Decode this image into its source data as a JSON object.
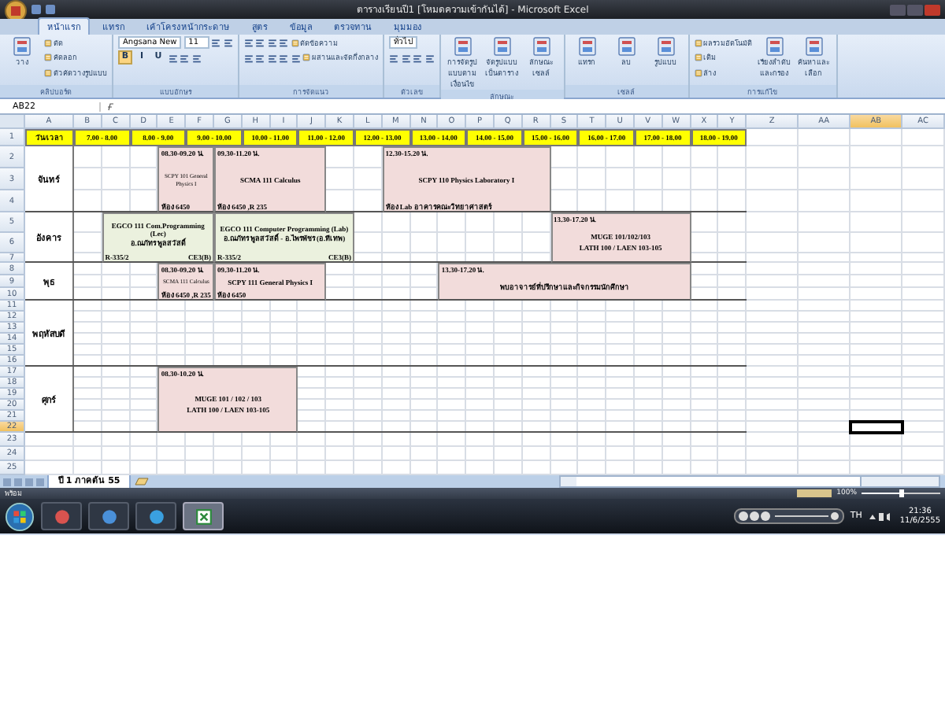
{
  "window": {
    "title": "ตารางเรียนปี1 [โหมดความเข้ากันได้] - Microsoft Excel"
  },
  "ribbon": {
    "tabs": [
      {
        "label": "หน้าแรก",
        "selected": true
      },
      {
        "label": "แทรก",
        "selected": false
      },
      {
        "label": "เค้าโครงหน้ากระดาษ",
        "selected": false
      },
      {
        "label": "สูตร",
        "selected": false
      },
      {
        "label": "ข้อมูล",
        "selected": false
      },
      {
        "label": "ตรวจทาน",
        "selected": false
      },
      {
        "label": "มุมมอง",
        "selected": false
      }
    ],
    "groups": [
      {
        "label": "คลิปบอร์ด",
        "parts": [
          {
            "kind": "large",
            "label": "วาง"
          },
          {
            "kind": "stack",
            "lines": [
              {
                "items": [
                  {
                    "kind": "small",
                    "label": "ตัด"
                  }
                ]
              },
              {
                "items": [
                  {
                    "kind": "small",
                    "label": "คัดลอก"
                  }
                ]
              },
              {
                "items": [
                  {
                    "kind": "small",
                    "label": "ตัวคัดวางรูปแบบ"
                  }
                ]
              }
            ]
          }
        ]
      },
      {
        "label": "แบบอักษร",
        "parts": [
          {
            "kind": "stack",
            "lines": [
              {
                "items": [
                  {
                    "kind": "field",
                    "value": "Angsana New"
                  },
                  {
                    "kind": "field",
                    "value": "11"
                  },
                  {
                    "kind": "tool"
                  },
                  {
                    "kind": "tool"
                  }
                ]
              },
              {
                "items": [
                  {
                    "kind": "glyph",
                    "label": "B",
                    "on": true
                  },
                  {
                    "kind": "glyph",
                    "label": "I",
                    "on": false
                  },
                  {
                    "kind": "glyph",
                    "label": "U",
                    "on": false
                  },
                  {
                    "kind": "tool"
                  },
                  {
                    "kind": "tool"
                  },
                  {
                    "kind": "tool"
                  }
                ]
              }
            ]
          }
        ]
      },
      {
        "label": "การจัดแนว",
        "parts": [
          {
            "kind": "stack",
            "lines": [
              {
                "items": [
                  {
                    "kind": "tool"
                  },
                  {
                    "kind": "tool"
                  },
                  {
                    "kind": "tool"
                  },
                  {
                    "kind": "tool"
                  },
                  {
                    "kind": "small",
                    "label": "ตัดข้อความ"
                  }
                ]
              },
              {
                "items": [
                  {
                    "kind": "tool"
                  },
                  {
                    "kind": "tool"
                  },
                  {
                    "kind": "tool"
                  },
                  {
                    "kind": "tool"
                  },
                  {
                    "kind": "tool"
                  },
                  {
                    "kind": "small",
                    "label": "ผสานและจัดกึ่งกลาง"
                  }
                ]
              }
            ]
          }
        ]
      },
      {
        "label": "ตัวเลข",
        "parts": [
          {
            "kind": "stack",
            "lines": [
              {
                "items": [
                  {
                    "kind": "field",
                    "value": "ทั่วไป"
                  }
                ]
              },
              {
                "items": [
                  {
                    "kind": "tool"
                  },
                  {
                    "kind": "tool"
                  },
                  {
                    "kind": "tool"
                  },
                  {
                    "kind": "tool"
                  }
                ]
              }
            ]
          }
        ]
      },
      {
        "label": "ลักษณะ",
        "parts": [
          {
            "kind": "large",
            "label": "การจัดรูปแบบตามเงื่อนไข"
          },
          {
            "kind": "large",
            "label": "จัดรูปแบบเป็นตาราง"
          },
          {
            "kind": "large",
            "label": "ลักษณะเซลล์"
          }
        ]
      },
      {
        "label": "เซลล์",
        "parts": [
          {
            "kind": "large",
            "label": "แทรก"
          },
          {
            "kind": "large",
            "label": "ลบ"
          },
          {
            "kind": "large",
            "label": "รูปแบบ"
          }
        ]
      },
      {
        "label": "การแก้ไข",
        "parts": [
          {
            "kind": "stack",
            "lines": [
              {
                "items": [
                  {
                    "kind": "small",
                    "label": "ผลรวมอัตโนมัติ"
                  }
                ]
              },
              {
                "items": [
                  {
                    "kind": "small",
                    "label": "เติม"
                  }
                ]
              },
              {
                "items": [
                  {
                    "kind": "small",
                    "label": "ล้าง"
                  }
                ]
              }
            ]
          },
          {
            "kind": "large",
            "label": "เรียงลำดับและกรอง"
          },
          {
            "kind": "large",
            "label": "ค้นหาและเลือก"
          }
        ]
      }
    ]
  },
  "formula_bar": {
    "name_box": "AB22"
  },
  "sheet": {
    "columns": [
      {
        "label": "A",
        "selected": false
      },
      {
        "label": "B",
        "selected": false
      },
      {
        "label": "C",
        "selected": false
      },
      {
        "label": "D",
        "selected": false
      },
      {
        "label": "E",
        "selected": false
      },
      {
        "label": "F",
        "selected": false
      },
      {
        "label": "G",
        "selected": false
      },
      {
        "label": "H",
        "selected": false
      },
      {
        "label": "I",
        "selected": false
      },
      {
        "label": "J",
        "selected": false
      },
      {
        "label": "K",
        "selected": false
      },
      {
        "label": "L",
        "selected": false
      },
      {
        "label": "M",
        "selected": false
      },
      {
        "label": "N",
        "selected": false
      },
      {
        "label": "O",
        "selected": false
      },
      {
        "label": "P",
        "selected": false
      },
      {
        "label": "Q",
        "selected": false
      },
      {
        "label": "R",
        "selected": false
      },
      {
        "label": "S",
        "selected": false
      },
      {
        "label": "T",
        "selected": false
      },
      {
        "label": "U",
        "selected": false
      },
      {
        "label": "V",
        "selected": false
      },
      {
        "label": "W",
        "selected": false
      },
      {
        "label": "X",
        "selected": false
      },
      {
        "label": "Y",
        "selected": false
      },
      {
        "label": "Z",
        "selected": false
      },
      {
        "label": "AA",
        "selected": false
      },
      {
        "label": "AB",
        "selected": true
      },
      {
        "label": "AC",
        "selected": false
      }
    ],
    "header_row": {
      "label": "1",
      "selected": false,
      "corner": "วัน/เวลา",
      "slots": [
        "7.00 - 8.00",
        "8.00 - 9.00",
        "9.00 - 10.00",
        "10.00 - 11.00",
        "11.00 - 12.00",
        "12.00 - 13.00",
        "13.00 - 14.00",
        "14.00 - 15.00",
        "15.00 - 16.00",
        "16.00 - 17.00",
        "17.00 - 18.00",
        "18.00 - 19.00"
      ]
    },
    "days": [
      {
        "label": "จันทร์",
        "rows": [
          {
            "label": "2",
            "selected": false
          },
          {
            "label": "3",
            "selected": false
          },
          {
            "label": "4",
            "selected": false
          }
        ],
        "cells": [
          "",
          "",
          "",
          {
            "colspan": 2,
            "color": "#f2dcdb",
            "time": "08.30-09.20 น.",
            "course": [
              "SCPY 101 General Physics I"
            ],
            "small": true,
            "room": "ห้อง 6450"
          },
          {
            "colspan": 4,
            "color": "#f2dcdb",
            "time": "09.30-11.20 น.",
            "course": [
              "SCMA 111 Calculus"
            ],
            "small": false,
            "room": "ห้อง 6450 ,R 235"
          },
          "",
          "",
          {
            "colspan": 6,
            "color": "#f2dcdb",
            "time": "12.30-15.20 น.",
            "course": [
              "SCPY 110 Physics Laboratory I"
            ],
            "small": false,
            "room": "ห้อง Lab อาคารคณะวิทยาศาสตร์"
          }
        ]
      },
      {
        "label": "อังคาร",
        "rows": [
          {
            "label": "5",
            "selected": false
          },
          {
            "label": "6",
            "selected": false
          },
          {
            "label": "7",
            "selected": false
          }
        ],
        "cells": [
          "",
          {
            "colspan": 4,
            "color": "#ebf1de",
            "course": [
              "EGCO 111 Com.Programming (Lec)",
              "อ.ณภัทร พูลสวัสดิ์"
            ],
            "small": false,
            "footer_left": "R-335/2",
            "footer_right": "CE3(B)"
          },
          {
            "colspan": 5,
            "color": "#ebf1de",
            "course": [
              "EGCO 111 Computer Programming (Lab)",
              "อ.ณภัทร พูลสวัสดิ์ - อ.ไพรพัชร (อ.ทีเทพ)"
            ],
            "small": false,
            "footer_left": "R-335/2",
            "footer_right": "CE3(B)"
          },
          "",
          "",
          "",
          "",
          "",
          "",
          "",
          {
            "colspan": 5,
            "color": "#f2dcdb",
            "time": "13.30-17.20 น.",
            "course": [
              "MUGE 101/102/103",
              "LATH 100 / LAEN 103-105"
            ],
            "small": false
          }
        ]
      },
      {
        "label": "พุธ",
        "rows": [
          {
            "label": "8",
            "selected": false
          },
          {
            "label": "9",
            "selected": false
          },
          {
            "label": "10",
            "selected": false
          }
        ],
        "cells": [
          "",
          "",
          "",
          {
            "colspan": 2,
            "color": "#f2dcdb",
            "time": "08.30-09.20 น.",
            "course": [
              "SCMA 111 Calculus"
            ],
            "small": true,
            "room": "ห้อง 6450 ,R 235"
          },
          {
            "colspan": 4,
            "color": "#f2dcdb",
            "time": "09.30-11.20 น.",
            "course": [
              "SCPY 111 General Physics I"
            ],
            "small": false,
            "room": "ห้อง 6450"
          },
          "",
          "",
          "",
          "",
          {
            "colspan": 9,
            "color": "#f2dcdb",
            "time": "13.30-17.20 น.",
            "course": [
              "พบอาจารย์ที่ปรึกษาและกิจกรรมนักศึกษา"
            ],
            "small": false
          }
        ]
      },
      {
        "label": "พฤหัสบดี",
        "rows": [
          {
            "label": "11",
            "selected": false
          },
          {
            "label": "12",
            "selected": false
          },
          {
            "label": "13",
            "selected": false
          },
          {
            "label": "14",
            "selected": false
          },
          {
            "label": "15",
            "selected": false
          },
          {
            "label": "16",
            "selected": false
          }
        ]
      },
      {
        "label": "ศุกร์",
        "rows": [
          {
            "label": "17",
            "selected": false
          },
          {
            "label": "18",
            "selected": false
          },
          {
            "label": "19",
            "selected": false
          },
          {
            "label": "20",
            "selected": false
          },
          {
            "label": "21",
            "selected": false
          },
          {
            "label": "22",
            "selected": true
          }
        ],
        "cells": [
          "",
          "",
          "",
          {
            "colspan": 5,
            "color": "#f2dcdb",
            "time": "08.30-10.20 น.",
            "course": [
              "MUGE 101 / 102 / 103",
              "LATH 100 / LAEN 103-105"
            ],
            "small": false
          }
        ]
      }
    ],
    "extra_rows": [
      {
        "label": "23",
        "selected": false
      },
      {
        "label": "24",
        "selected": false
      },
      {
        "label": "25",
        "selected": false
      }
    ],
    "tabs": [
      {
        "label": "ปี 1 ภาคต้น 55",
        "selected": true
      }
    ]
  },
  "status_bar": {
    "text": "พร้อม",
    "zoom": {
      "text": "100%",
      "level": 0.5
    }
  },
  "taskbar": {
    "apps": [
      {
        "kind": "browser",
        "selected": false
      },
      {
        "kind": "globe",
        "selected": false
      },
      {
        "kind": "bird",
        "selected": false
      },
      {
        "kind": "sheet",
        "selected": true
      }
    ],
    "language": "TH",
    "time": "21:36",
    "date": "11/6/2555"
  }
}
